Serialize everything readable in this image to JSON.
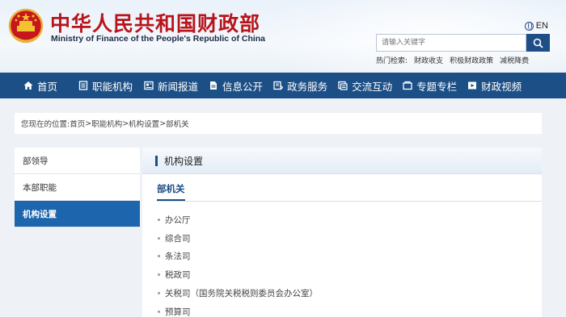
{
  "header": {
    "title_cn": "中华人民共和国财政部",
    "title_en": "Ministry of Finance of the People's Republic of China",
    "lang_label": "EN",
    "search_placeholder": "请输入关键字",
    "hot_label": "热门检索:",
    "hot_links": [
      "财政收支",
      "积极财政政策",
      "减税降费"
    ]
  },
  "nav": {
    "items": [
      {
        "label": "首页",
        "icon": "home-icon"
      },
      {
        "label": "职能机构",
        "icon": "document-list-icon"
      },
      {
        "label": "新闻报道",
        "icon": "newspaper-icon"
      },
      {
        "label": "信息公开",
        "icon": "file-icon"
      },
      {
        "label": "政务服务",
        "icon": "service-icon"
      },
      {
        "label": "交流互动",
        "icon": "chat-icon"
      },
      {
        "label": "专题专栏",
        "icon": "folder-icon"
      },
      {
        "label": "财政视频",
        "icon": "video-icon"
      }
    ]
  },
  "breadcrumb": {
    "prefix": "您现在的位置:",
    "items": [
      "首页",
      "职能机构",
      "机构设置",
      "部机关"
    ],
    "separator": ">"
  },
  "sidebar": {
    "items": [
      {
        "label": "部领导",
        "active": false
      },
      {
        "label": "本部职能",
        "active": false
      },
      {
        "label": "机构设置",
        "active": true
      }
    ]
  },
  "main": {
    "panel_title": "机构设置",
    "sub_title": "部机关",
    "departments": [
      "办公厅",
      "综合司",
      "条法司",
      "税政司",
      "关税司（国务院关税税则委员会办公室）",
      "预算司"
    ]
  },
  "colors": {
    "brand_red": "#b8141b",
    "nav_blue": "#1c4f86",
    "active_blue": "#1d65ad"
  }
}
